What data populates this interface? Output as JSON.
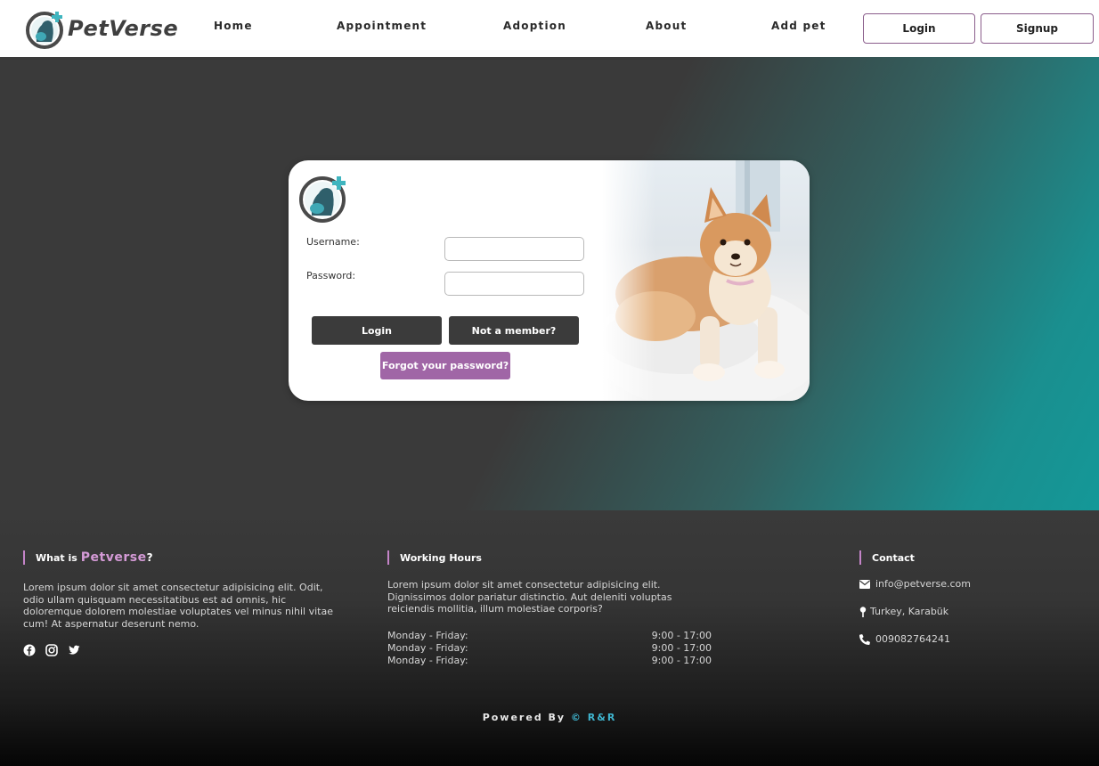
{
  "header": {
    "brand": "PetVerse",
    "nav": [
      "Home",
      "Appointment",
      "Adoption",
      "About",
      "Add pet"
    ],
    "login_label": "Login",
    "signup_label": "Signup"
  },
  "login_form": {
    "username_label": "Username:",
    "password_label": "Password:",
    "username_value": "",
    "password_value": "",
    "login_button": "Login",
    "member_button": "Not a member?",
    "forgot_button": "Forgot your password?"
  },
  "footer": {
    "about": {
      "heading_prefix": "What is",
      "heading_brand": "Petverse",
      "heading_suffix": "?",
      "text": "Lorem ipsum dolor sit amet consectetur adipisicing elit. Odit, odio ullam quisquam necessitatibus est ad omnis, hic doloremque dolorem molestiae voluptates vel minus nihil vitae cum! At aspernatur deserunt nemo."
    },
    "hours": {
      "heading": "Working Hours",
      "text": "Lorem ipsum dolor sit amet consectetur adipisicing elit. Dignissimos dolor pariatur distinctio. Aut deleniti voluptas reiciendis mollitia, illum molestiae corporis?",
      "rows": [
        {
          "day": "Monday - Friday:",
          "time": "9:00 - 17:00"
        },
        {
          "day": "Monday - Friday:",
          "time": "9:00 - 17:00"
        },
        {
          "day": "Monday - Friday:",
          "time": "9:00 - 17:00"
        }
      ]
    },
    "contact": {
      "heading": "Contact",
      "email": "info@petverse.com",
      "location": "Turkey, Karabük",
      "phone": "009082764241"
    },
    "social_icons": [
      "facebook-icon",
      "instagram-icon",
      "twitter-icon"
    ],
    "powered_prefix": "Powered By",
    "powered_brand": "© R&R"
  },
  "colors": {
    "accent_purple": "#a066a6",
    "teal": "#149898",
    "dark": "#3a3a3a",
    "link_blue": "#3fb5cf"
  }
}
